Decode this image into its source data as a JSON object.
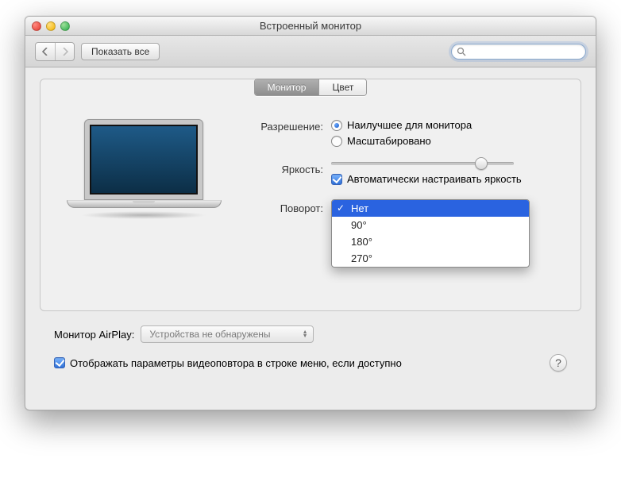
{
  "window": {
    "title": "Встроенный монитор"
  },
  "toolbar": {
    "show_all": "Показать все",
    "search_placeholder": ""
  },
  "tabs": {
    "monitor": "Монитор",
    "color": "Цвет"
  },
  "resolution": {
    "label": "Разрешение:",
    "best": "Наилучшее для монитора",
    "scaled": "Масштабировано"
  },
  "brightness": {
    "label": "Яркость:",
    "auto": "Автоматически настраивать яркость"
  },
  "rotation": {
    "label": "Поворот:",
    "options": [
      "Нет",
      "90°",
      "180°",
      "270°"
    ]
  },
  "airplay": {
    "label": "Монитор AirPlay:",
    "value": "Устройства не обнаружены"
  },
  "mirror": {
    "label": "Отображать параметры видеоповтора в строке меню, если доступно"
  }
}
